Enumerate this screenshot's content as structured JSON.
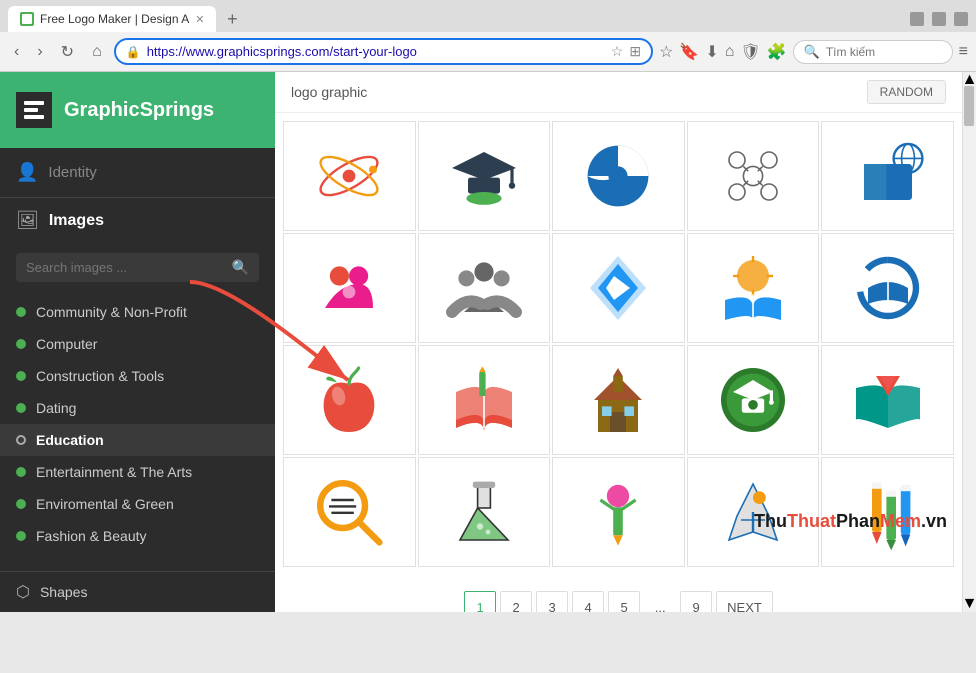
{
  "browser": {
    "tab_title": "Free Logo Maker | Design A",
    "url": "https://www.graphicsprings.com/start-your-logo",
    "search_placeholder": "Tìm kiếm"
  },
  "sidebar": {
    "brand": "GraphicSprings",
    "identity_label": "Identity",
    "images_label": "Images",
    "search_placeholder": "Search images ...",
    "nav_items": [
      {
        "label": "Community & Non-Profit",
        "active": false
      },
      {
        "label": "Computer",
        "active": false
      },
      {
        "label": "Construction & Tools",
        "active": false
      },
      {
        "label": "Dating",
        "active": false
      },
      {
        "label": "Education",
        "active": true
      },
      {
        "label": "Entertainment & The Arts",
        "active": false
      },
      {
        "label": "Enviromental & Green",
        "active": false
      },
      {
        "label": "Fashion & Beauty",
        "active": false
      }
    ],
    "shapes_label": "Shapes"
  },
  "content": {
    "title": "logo graphic",
    "random_btn": "RANDOM",
    "pagination": [
      "1",
      "2",
      "3",
      "4",
      "5",
      "...",
      "9",
      "NEXT"
    ]
  },
  "watermark": {
    "part1": "Thu",
    "part2": "Thuat",
    "part3": "Phan",
    "part4": "Mem",
    "part5": ".vn"
  }
}
